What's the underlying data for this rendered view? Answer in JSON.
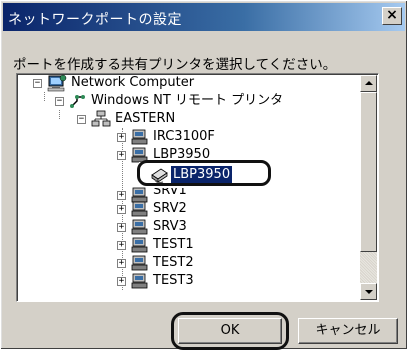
{
  "window": {
    "title": "ネットワークポートの設定",
    "close_glyph": "×"
  },
  "prompt": "ポートを作成する共有プリンタを選択してください。",
  "tree": {
    "root": "Network Computer",
    "network": "Windows NT リモート プリンタ",
    "domain": "EASTERN",
    "items": [
      {
        "label": "IRC3100F",
        "expander": "+"
      },
      {
        "label": "LBP3950",
        "expander": "+"
      },
      {
        "label": "LBP3950",
        "selected": true
      },
      {
        "label": "SRV1",
        "expander": "+"
      },
      {
        "label": "SRV2",
        "expander": "+"
      },
      {
        "label": "SRV3",
        "expander": "+"
      },
      {
        "label": "TEST1",
        "expander": "+"
      },
      {
        "label": "TEST2",
        "expander": "+"
      },
      {
        "label": "TEST3",
        "expander": "+"
      }
    ],
    "root_expander": "−",
    "network_expander": "−",
    "domain_expander": "−"
  },
  "buttons": {
    "ok": "OK",
    "cancel": "キャンセル"
  },
  "colors": {
    "titlebar_start": "#0a246a",
    "titlebar_end": "#a6caf0",
    "selection": "#0a246a",
    "face": "#d4d0c8"
  }
}
